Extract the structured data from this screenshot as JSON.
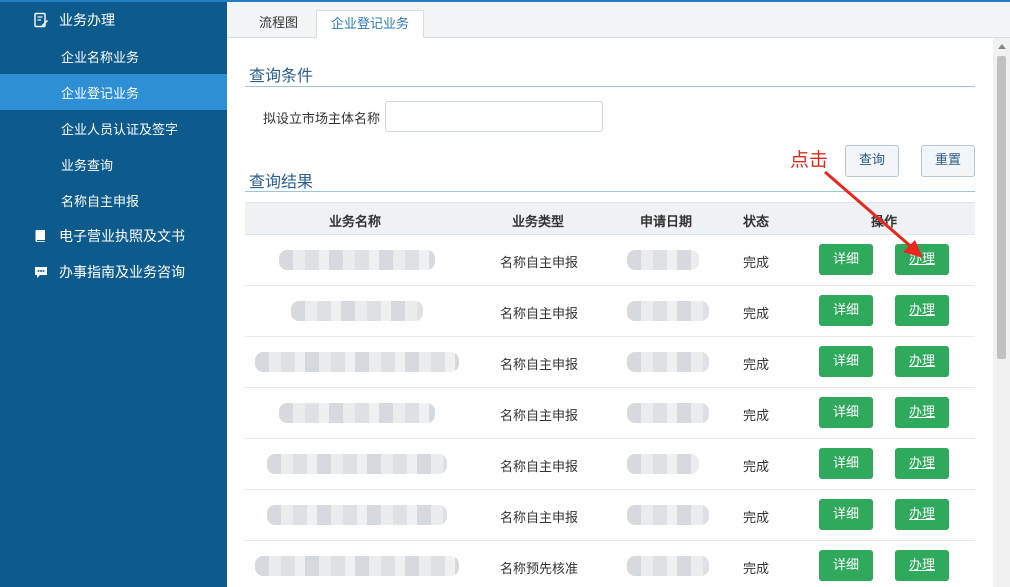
{
  "sidebar": {
    "groups": [
      {
        "label": "业务办理",
        "icon": "edit-document-icon"
      },
      {
        "label": "电子营业执照及文书",
        "icon": "book-icon"
      },
      {
        "label": "办事指南及业务咨询",
        "icon": "chat-bubble-icon"
      }
    ],
    "items": [
      {
        "label": "企业名称业务"
      },
      {
        "label": "企业登记业务"
      },
      {
        "label": "企业人员认证及签字"
      },
      {
        "label": "业务查询"
      },
      {
        "label": "名称自主申报"
      }
    ]
  },
  "tabs": [
    {
      "label": "流程图"
    },
    {
      "label": "企业登记业务"
    }
  ],
  "query": {
    "title": "查询条件",
    "field_label": "拟设立市场主体名称",
    "field_value": "",
    "search_button": "查询",
    "reset_button": "重置"
  },
  "annotation": "点击",
  "results": {
    "title": "查询结果",
    "columns": [
      "业务名称",
      "业务类型",
      "申请日期",
      "状态",
      "操作"
    ],
    "rows": [
      {
        "type": "名称自主申报",
        "status": "完成",
        "detail": "详细",
        "handle": "办理"
      },
      {
        "type": "名称自主申报",
        "status": "完成",
        "detail": "详细",
        "handle": "办理"
      },
      {
        "type": "名称自主申报",
        "status": "完成",
        "detail": "详细",
        "handle": "办理"
      },
      {
        "type": "名称自主申报",
        "status": "完成",
        "detail": "详细",
        "handle": "办理"
      },
      {
        "type": "名称自主申报",
        "status": "完成",
        "detail": "详细",
        "handle": "办理"
      },
      {
        "type": "名称自主申报",
        "status": "完成",
        "detail": "详细",
        "handle": "办理"
      },
      {
        "type": "名称预先核准",
        "status": "完成",
        "detail": "详细",
        "handle": "办理"
      }
    ]
  },
  "colors": {
    "sidebar_bg": "#0d5a8c",
    "sidebar_active": "#2e8fd4",
    "green_button": "#2faa5c",
    "annotation_red": "#e8281e"
  }
}
